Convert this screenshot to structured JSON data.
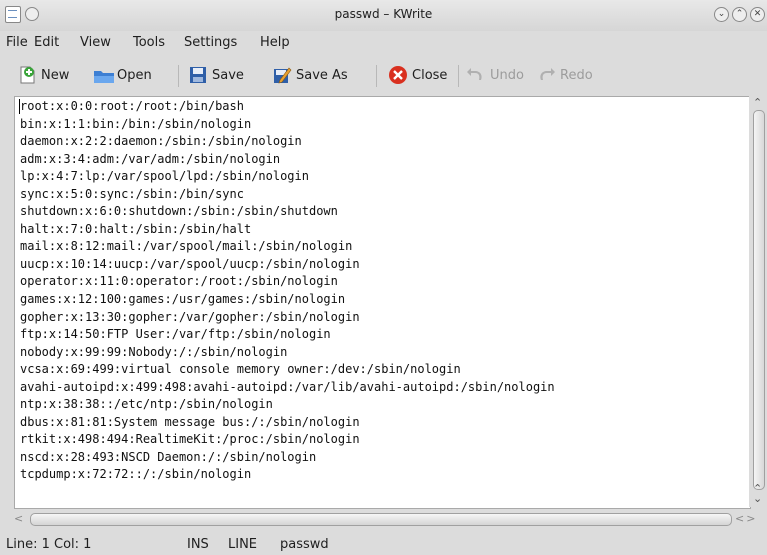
{
  "window": {
    "title": "passwd – KWrite"
  },
  "menu": [
    "File",
    "Edit",
    "View",
    "Tools",
    "Settings",
    "Help"
  ],
  "toolbar": {
    "new_label": "New",
    "open_label": "Open",
    "save_label": "Save",
    "save_as_label": "Save As",
    "close_label": "Close",
    "undo_label": "Undo",
    "redo_label": "Redo"
  },
  "editor": {
    "lines": [
      "root:x:0:0:root:/root:/bin/bash",
      "bin:x:1:1:bin:/bin:/sbin/nologin",
      "daemon:x:2:2:daemon:/sbin:/sbin/nologin",
      "adm:x:3:4:adm:/var/adm:/sbin/nologin",
      "lp:x:4:7:lp:/var/spool/lpd:/sbin/nologin",
      "sync:x:5:0:sync:/sbin:/bin/sync",
      "shutdown:x:6:0:shutdown:/sbin:/sbin/shutdown",
      "halt:x:7:0:halt:/sbin:/sbin/halt",
      "mail:x:8:12:mail:/var/spool/mail:/sbin/nologin",
      "uucp:x:10:14:uucp:/var/spool/uucp:/sbin/nologin",
      "operator:x:11:0:operator:/root:/sbin/nologin",
      "games:x:12:100:games:/usr/games:/sbin/nologin",
      "gopher:x:13:30:gopher:/var/gopher:/sbin/nologin",
      "ftp:x:14:50:FTP User:/var/ftp:/sbin/nologin",
      "nobody:x:99:99:Nobody:/:/sbin/nologin",
      "vcsa:x:69:499:virtual console memory owner:/dev:/sbin/nologin",
      "avahi-autoipd:x:499:498:avahi-autoipd:/var/lib/avahi-autoipd:/sbin/nologin",
      "ntp:x:38:38::/etc/ntp:/sbin/nologin",
      "dbus:x:81:81:System message bus:/:/sbin/nologin",
      "rtkit:x:498:494:RealtimeKit:/proc:/sbin/nologin",
      "nscd:x:28:493:NSCD Daemon:/:/sbin/nologin",
      "tcpdump:x:72:72::/:/sbin/nologin"
    ]
  },
  "status": {
    "position": "Line: 1 Col: 1",
    "mode": "INS",
    "select_mode": "LINE",
    "filename": "passwd"
  }
}
